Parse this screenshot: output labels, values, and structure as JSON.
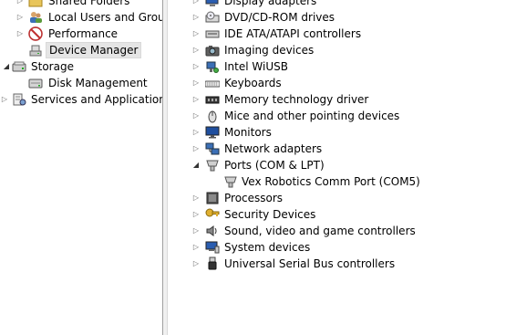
{
  "left_tree": [
    {
      "label": "Shared Folders",
      "icon": "shared-folders-icon"
    },
    {
      "label": "Local Users and Groups",
      "icon": "local-users-icon"
    },
    {
      "label": "Performance",
      "icon": "performance-icon"
    },
    {
      "label": "Device Manager",
      "icon": "device-manager-icon",
      "selected": true
    },
    {
      "label": "Storage",
      "icon": "storage-icon",
      "expanded": true
    },
    {
      "label": "Disk Management",
      "icon": "disk-management-icon"
    },
    {
      "label": "Services and Applications",
      "icon": "services-applications-icon"
    }
  ],
  "device_tree": [
    {
      "label": "Display adapters",
      "icon": "display-adapter-icon"
    },
    {
      "label": "DVD/CD-ROM drives",
      "icon": "dvd-drive-icon"
    },
    {
      "label": "IDE ATA/ATAPI controllers",
      "icon": "ide-controller-icon"
    },
    {
      "label": "Imaging devices",
      "icon": "imaging-device-icon"
    },
    {
      "label": "Intel WiUSB",
      "icon": "wiusb-icon"
    },
    {
      "label": "Keyboards",
      "icon": "keyboard-icon"
    },
    {
      "label": "Memory technology driver",
      "icon": "memory-driver-icon"
    },
    {
      "label": "Mice and other pointing devices",
      "icon": "mouse-icon"
    },
    {
      "label": "Monitors",
      "icon": "monitor-icon"
    },
    {
      "label": "Network adapters",
      "icon": "network-adapter-icon"
    },
    {
      "label": "Ports (COM & LPT)",
      "icon": "port-icon",
      "expanded": true
    },
    {
      "label": "Vex Robotics Comm Port (COM5)",
      "icon": "com-port-icon",
      "child": true
    },
    {
      "label": "Processors",
      "icon": "processor-icon"
    },
    {
      "label": "Security Devices",
      "icon": "security-device-icon"
    },
    {
      "label": "Sound, video and game controllers",
      "icon": "sound-icon"
    },
    {
      "label": "System devices",
      "icon": "system-device-icon"
    },
    {
      "label": "Universal Serial Bus controllers",
      "icon": "usb-icon"
    }
  ]
}
